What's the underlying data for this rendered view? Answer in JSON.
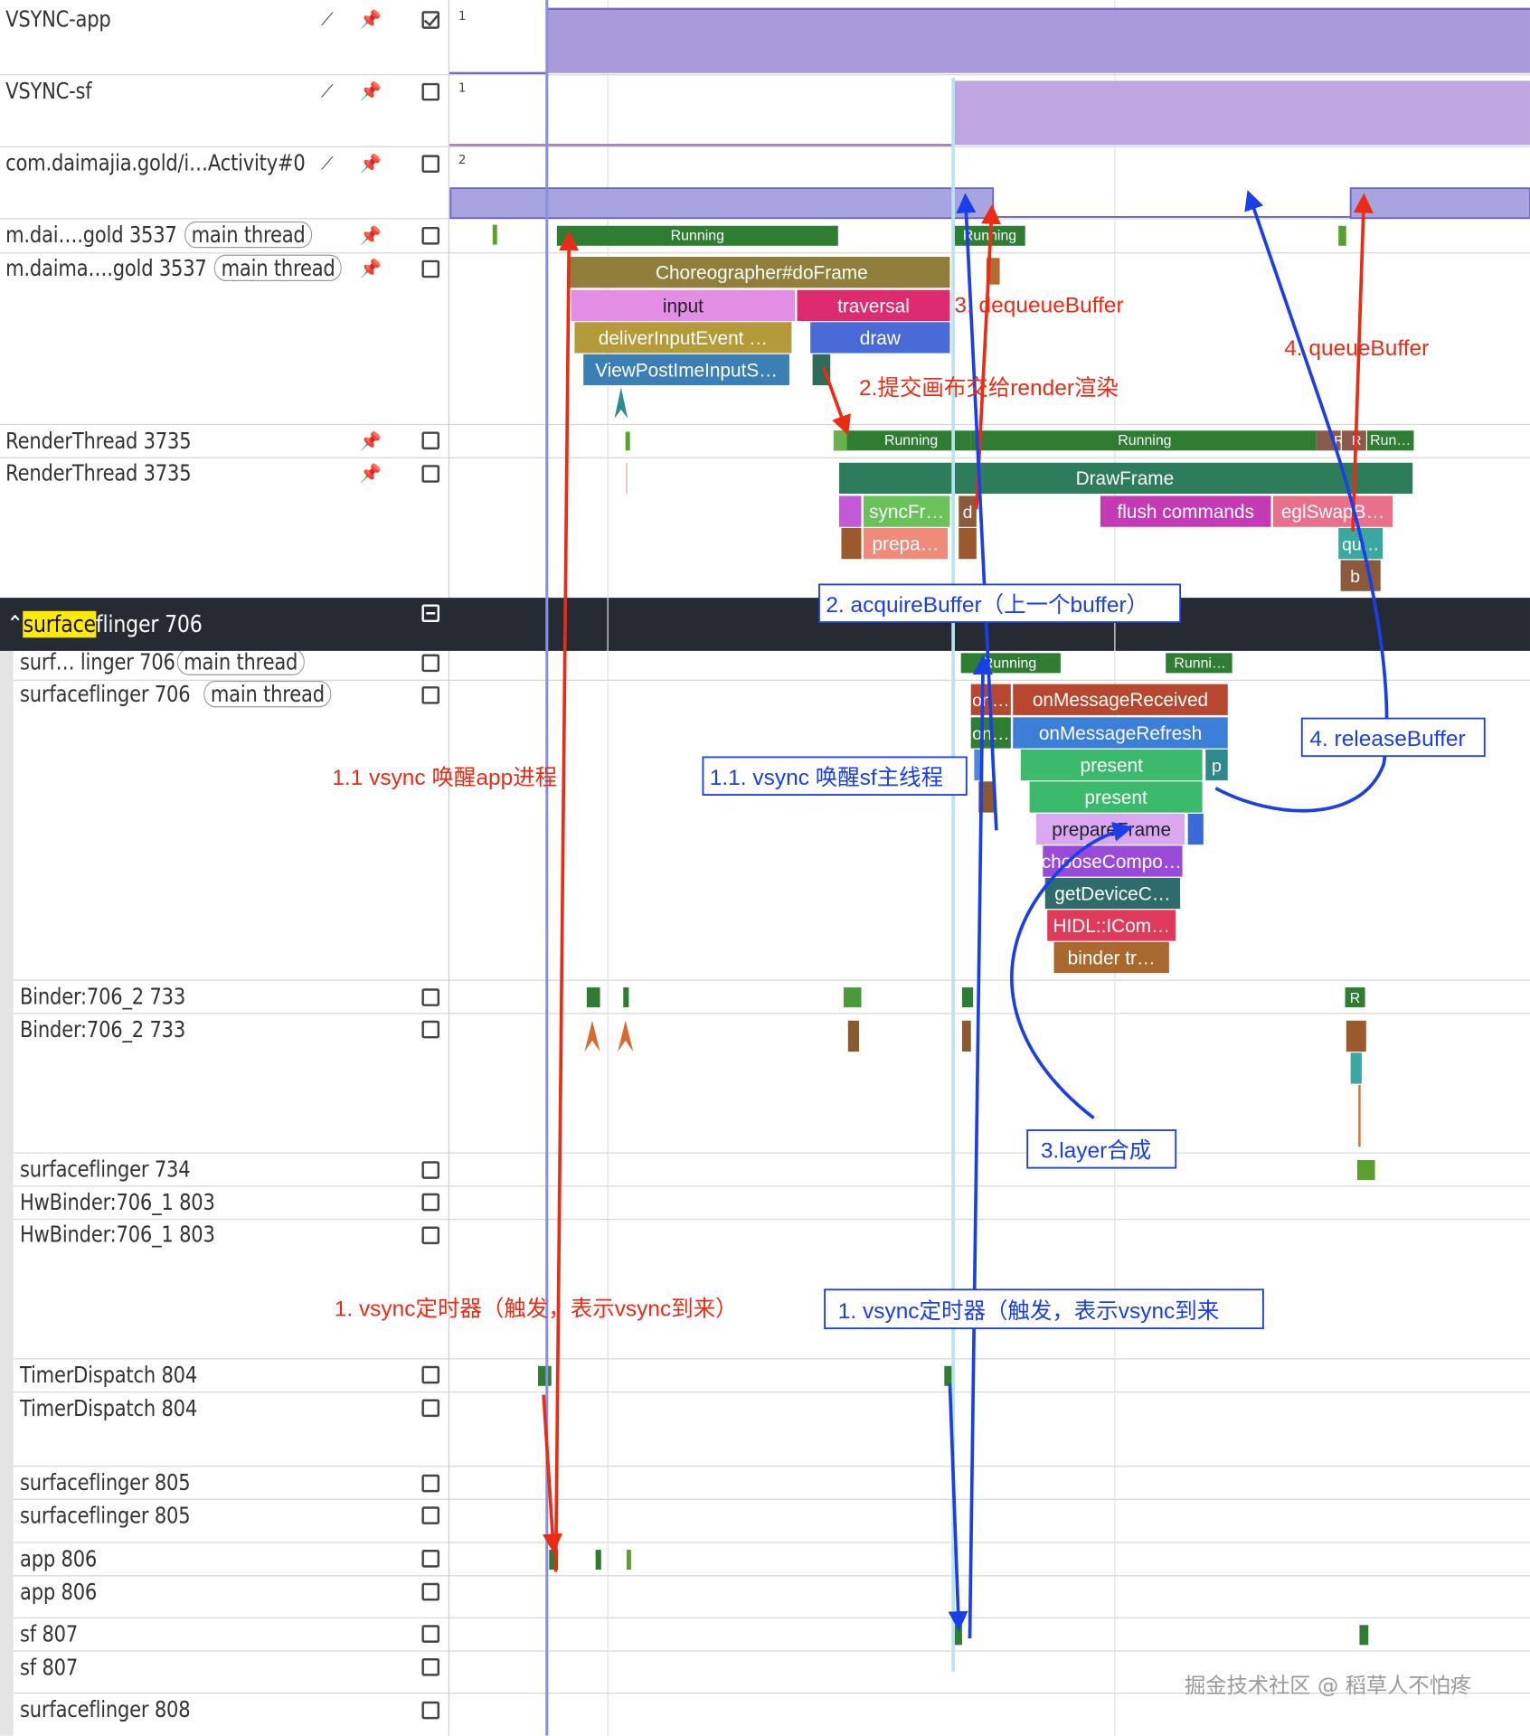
{
  "tracks": {
    "vsync_app": {
      "label": "VSYNC-app",
      "count": "1",
      "checked": true
    },
    "vsync_sf": {
      "label": "VSYNC-sf",
      "count": "1"
    },
    "activity": {
      "label": "com.daimajia.gold/i…Activity#0",
      "count": "2"
    },
    "main1": {
      "label": "m.dai….gold 3537",
      "tag": "main thread"
    },
    "main2": {
      "label": "m.daima….gold 3537",
      "tag": "main thread"
    },
    "rt1": {
      "label": "RenderThread 3735"
    },
    "rt2": {
      "label": "RenderThread 3735"
    },
    "sf_group": {
      "label_hl": "surface",
      "label_rest": "flinger 706"
    },
    "sf1": {
      "label": "surf… linger 706",
      "tag": "main thread"
    },
    "sf2": {
      "label": "surfaceflinger 706",
      "tag": "main thread"
    },
    "binder1": {
      "label": "Binder:706_2 733"
    },
    "binder2": {
      "label": "Binder:706_2 733"
    },
    "sf734": {
      "label": "surfaceflinger 734"
    },
    "hw1": {
      "label": "HwBinder:706_1 803"
    },
    "hw2": {
      "label": "HwBinder:706_1 803"
    },
    "timer1": {
      "label": "TimerDispatch 804"
    },
    "timer2": {
      "label": "TimerDispatch 804"
    },
    "sf805a": {
      "label": "surfaceflinger 805"
    },
    "sf805b": {
      "label": "surfaceflinger 805"
    },
    "app806a": {
      "label": "app 806"
    },
    "app806b": {
      "label": "app 806"
    },
    "sf807a": {
      "label": "sf 807"
    },
    "sf807b": {
      "label": "sf 807"
    },
    "sf808": {
      "label": "surfaceflinger 808"
    }
  },
  "slices": {
    "running1": "Running",
    "running2": "Running",
    "choreographer": "Choreographer#doFrame",
    "input": "input",
    "traversal": "traversal",
    "deliverInputEvent": "deliverInputEvent …",
    "draw": "draw",
    "viewPostIme": "ViewPostImeInputS…",
    "rt_running1": "Running",
    "rt_running2": "Running",
    "rt_r1": "R",
    "rt_r2": "R",
    "rt_run": "Run…",
    "drawframe": "DrawFrame",
    "syncfr": "syncFr…",
    "d": "d",
    "flush": "flush commands",
    "eglswap": "eglSwapB…",
    "prepa": "prepa…",
    "qu": "qu…",
    "b": "b",
    "sf_running": "Running",
    "sf_runni": "Runni…",
    "on1": "on…",
    "onMessageReceived": "onMessageReceived",
    "on2": "on…",
    "onMessageRefresh": "onMessageRefresh",
    "present1": "present",
    "p": "p",
    "present2": "present",
    "prepareFrame": "prepareFrame",
    "chooseCompo": "chooseCompo…",
    "getDeviceC": "getDeviceC…",
    "hidl": "HIDL::ICom…",
    "binder_tr": "binder tr…",
    "binder_r": "R"
  },
  "annotations": {
    "red_dequeue": "3. dequeueBuffer",
    "red_queue": "4. queueBuffer",
    "red_submit": "2.提交画布交给render渲染",
    "red_vsync_wake": "1.1 vsync 唤醒app进程",
    "red_vsync_timer": "1. vsync定时器（触发，表示vsync到来）",
    "blue_acquire": "2. acquireBuffer（上一个buffer）",
    "blue_release": "4. releaseBuffer",
    "blue_vsync_wake": "1.1. vsync 唤醒sf主线程",
    "blue_layer": "3.layer合成",
    "blue_vsync_timer": "1. vsync定时器（触发，表示vsync到来"
  },
  "watermark": "掘金技术社区 @ 稻草人不怕疼",
  "colors": {
    "red": "#ec2b14",
    "blue": "#1a3ee8",
    "vsync_fill": "#a89adb",
    "running": "#2e7d32"
  }
}
